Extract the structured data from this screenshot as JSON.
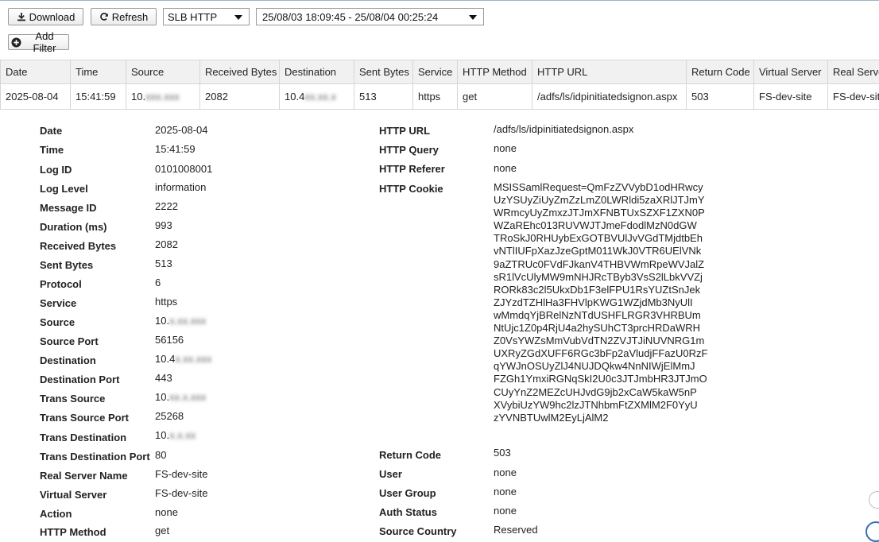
{
  "toolbar": {
    "download_label": "Download",
    "refresh_label": "Refresh",
    "log_type": "SLB HTTP",
    "time_range": "25/08/03 18:09:45 - 25/08/04 00:25:24",
    "add_filter_label": "Add Filter"
  },
  "table": {
    "columns": [
      "Date",
      "Time",
      "Source",
      "Received Bytes",
      "Destination",
      "Sent Bytes",
      "Service",
      "HTTP Method",
      "HTTP URL",
      "Return Code",
      "Virtual Server",
      "Real Server"
    ],
    "row": [
      "2025-08-04",
      "15:41:59",
      "10.",
      "2082",
      "10.4",
      "513",
      "https",
      "get",
      "/adfs/ls/idpinitiatedsignon.aspx",
      "503",
      "FS-dev-site",
      "FS-dev-site"
    ]
  },
  "details": {
    "left": [
      {
        "label": "Date",
        "value": "2025-08-04"
      },
      {
        "label": "Time",
        "value": "15:41:59"
      },
      {
        "label": "Log ID",
        "value": "0101008001"
      },
      {
        "label": "Log Level",
        "value": "information"
      },
      {
        "label": "Message ID",
        "value": "2222"
      },
      {
        "label": "Duration (ms)",
        "value": "993"
      },
      {
        "label": "Received Bytes",
        "value": "2082"
      },
      {
        "label": "Sent Bytes",
        "value": "513"
      },
      {
        "label": "Protocol",
        "value": "6"
      },
      {
        "label": "Service",
        "value": "https"
      },
      {
        "label": "Source",
        "value": "10."
      },
      {
        "label": "Source Port",
        "value": "56156"
      },
      {
        "label": "Destination",
        "value": "10.4"
      },
      {
        "label": "Destination Port",
        "value": "443"
      },
      {
        "label": "Trans Source",
        "value": "10."
      },
      {
        "label": "Trans Source Port",
        "value": "25268"
      },
      {
        "label": "Trans Destination",
        "value": "10."
      },
      {
        "label": "Trans Destination Port",
        "value": "80"
      },
      {
        "label": "Real Server Name",
        "value": "FS-dev-site"
      },
      {
        "label": "Virtual Server",
        "value": "FS-dev-site"
      },
      {
        "label": "Action",
        "value": "none"
      },
      {
        "label": "HTTP Method",
        "value": "get"
      }
    ],
    "right_top": [
      {
        "label": "HTTP URL",
        "value": "/adfs/ls/idpinitiatedsignon.aspx"
      },
      {
        "label": "HTTP Query",
        "value": "none"
      },
      {
        "label": "HTTP Referer",
        "value": "none"
      }
    ],
    "cookie_label": "HTTP Cookie",
    "cookie_lines": [
      "MSISSamlRequest=QmFzZVVybD1odHRwcy",
      "UzYSUyZiUyZmZzLmZ0LWRldi5zaXRlJTJmY",
      "WRmcyUyZmxzJTJmXFNBTUxSZXF1ZXN0P",
      "WZaREhc013RUVWJTJmeFdodlMzN0dGW",
      "TRoSkJ0RHUybExGOTBVUlJvVGdTMjdtbEh",
      "vNTlIUFpXazJzeGptM011WkJ0VTR6UElVNk",
      "9aZTRUc0FVdFJkanV4THBVWmRpeWVJalZ",
      "sR1lVcUlyMW9mNHJRcTByb3VsS2lLbkVVZj",
      "RORk83c2l5UkxDb1F3elFPU1RsYUZtSnJek",
      "ZJYzdTZHlHa3FHVlpKWG1WZjdMb3NyUlI",
      "wMmdqYjBRelNzNTdUSHFLRGR3VHRBUm",
      "NtUjc1Z0p4RjU4a2hySUhCT3prcHRDaWRH",
      "Z0VsYWZsMmVubVdTN2ZVJTJiNUVNRG1m",
      "UXRyZGdXUFF6RGc3bFp2aVludjFFazU0RzF",
      "qYWJnOSUyZlJ4NUJDQkw4NnNIWjElMmJ",
      "FZGh1YmxiRGNqSkI2U0c3JTJmbHR3JTJmO",
      "CUyYnZ2MEZcUHJvdG9jb2xCaW5kaW5nP",
      "XVybiUzYW9hc2lzJTNhbmFtZXMlM2F0YyU",
      "zYVNBTUwlM2EyLjAlM2"
    ],
    "right_bottom": [
      {
        "label": "Return Code",
        "value": "503"
      },
      {
        "label": "User",
        "value": "none"
      },
      {
        "label": "User Group",
        "value": "none"
      },
      {
        "label": "Auth Status",
        "value": "none"
      },
      {
        "label": "Source Country",
        "value": "Reserved"
      }
    ]
  },
  "icons": {
    "download": "download-icon",
    "refresh": "refresh-icon",
    "add_filter": "plus-circle-icon",
    "dropdown": "chevron-down-icon"
  }
}
